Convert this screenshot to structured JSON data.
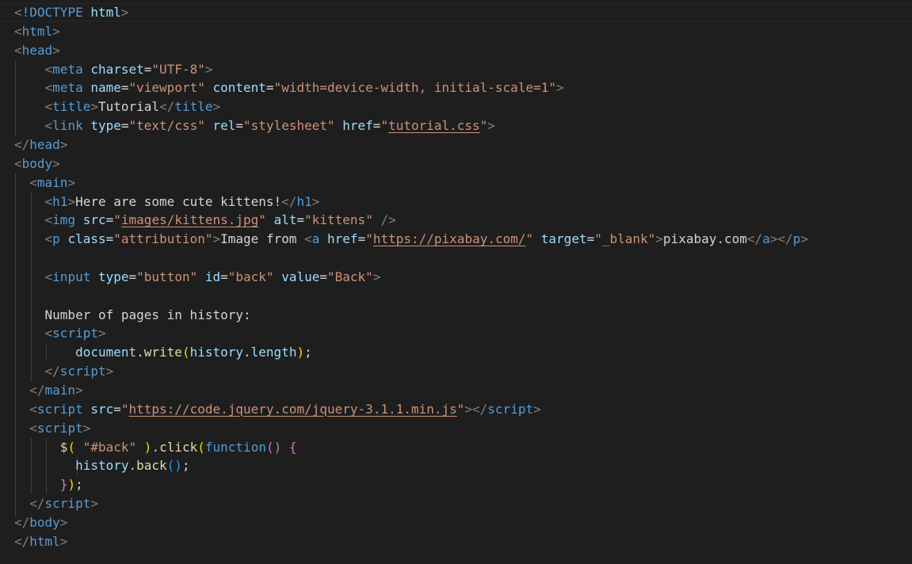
{
  "lines": [
    [
      {
        "t": "<",
        "c": "t-punc"
      },
      {
        "t": "!DOCTYPE",
        "c": "t-tag"
      },
      {
        "t": " ",
        "c": "t-text"
      },
      {
        "t": "html",
        "c": "t-attr"
      },
      {
        "t": ">",
        "c": "t-punc"
      }
    ],
    [
      {
        "t": "<",
        "c": "t-punc"
      },
      {
        "t": "html",
        "c": "t-tag"
      },
      {
        "t": ">",
        "c": "t-punc"
      }
    ],
    [
      {
        "t": "<",
        "c": "t-punc"
      },
      {
        "t": "head",
        "c": "t-tag"
      },
      {
        "t": ">",
        "c": "t-punc"
      }
    ],
    [
      {
        "t": "    ",
        "c": "t-text"
      },
      {
        "t": "<",
        "c": "t-punc"
      },
      {
        "t": "meta",
        "c": "t-tag"
      },
      {
        "t": " ",
        "c": "t-text"
      },
      {
        "t": "charset",
        "c": "t-attr"
      },
      {
        "t": "=",
        "c": "t-text"
      },
      {
        "t": "\"UTF-8\"",
        "c": "t-str"
      },
      {
        "t": ">",
        "c": "t-punc"
      }
    ],
    [
      {
        "t": "    ",
        "c": "t-text"
      },
      {
        "t": "<",
        "c": "t-punc"
      },
      {
        "t": "meta",
        "c": "t-tag"
      },
      {
        "t": " ",
        "c": "t-text"
      },
      {
        "t": "name",
        "c": "t-attr"
      },
      {
        "t": "=",
        "c": "t-text"
      },
      {
        "t": "\"viewport\"",
        "c": "t-str"
      },
      {
        "t": " ",
        "c": "t-text"
      },
      {
        "t": "content",
        "c": "t-attr"
      },
      {
        "t": "=",
        "c": "t-text"
      },
      {
        "t": "\"width=device-width, initial-scale=1\"",
        "c": "t-str"
      },
      {
        "t": ">",
        "c": "t-punc"
      }
    ],
    [
      {
        "t": "    ",
        "c": "t-text"
      },
      {
        "t": "<",
        "c": "t-punc"
      },
      {
        "t": "title",
        "c": "t-tag"
      },
      {
        "t": ">",
        "c": "t-punc"
      },
      {
        "t": "Tutorial",
        "c": "t-text"
      },
      {
        "t": "</",
        "c": "t-punc"
      },
      {
        "t": "title",
        "c": "t-tag"
      },
      {
        "t": ">",
        "c": "t-punc"
      }
    ],
    [
      {
        "t": "    ",
        "c": "t-text"
      },
      {
        "t": "<",
        "c": "t-punc"
      },
      {
        "t": "link",
        "c": "t-tag"
      },
      {
        "t": " ",
        "c": "t-text"
      },
      {
        "t": "type",
        "c": "t-attr"
      },
      {
        "t": "=",
        "c": "t-text"
      },
      {
        "t": "\"text/css\"",
        "c": "t-str"
      },
      {
        "t": " ",
        "c": "t-text"
      },
      {
        "t": "rel",
        "c": "t-attr"
      },
      {
        "t": "=",
        "c": "t-text"
      },
      {
        "t": "\"stylesheet\"",
        "c": "t-str"
      },
      {
        "t": " ",
        "c": "t-text"
      },
      {
        "t": "href",
        "c": "t-attr"
      },
      {
        "t": "=",
        "c": "t-text"
      },
      {
        "t": "\"",
        "c": "t-str"
      },
      {
        "t": "tutorial.css",
        "c": "t-link"
      },
      {
        "t": "\"",
        "c": "t-str"
      },
      {
        "t": ">",
        "c": "t-punc"
      }
    ],
    [
      {
        "t": "</",
        "c": "t-punc"
      },
      {
        "t": "head",
        "c": "t-tag"
      },
      {
        "t": ">",
        "c": "t-punc"
      }
    ],
    [
      {
        "t": "<",
        "c": "t-punc"
      },
      {
        "t": "body",
        "c": "t-tag"
      },
      {
        "t": ">",
        "c": "t-punc"
      }
    ],
    [
      {
        "t": "  ",
        "c": "t-text"
      },
      {
        "t": "<",
        "c": "t-punc"
      },
      {
        "t": "main",
        "c": "t-tag"
      },
      {
        "t": ">",
        "c": "t-punc"
      }
    ],
    [
      {
        "t": "    ",
        "c": "t-text"
      },
      {
        "t": "<",
        "c": "t-punc"
      },
      {
        "t": "h1",
        "c": "t-tag"
      },
      {
        "t": ">",
        "c": "t-punc"
      },
      {
        "t": "Here are some cute kittens!",
        "c": "t-text"
      },
      {
        "t": "</",
        "c": "t-punc"
      },
      {
        "t": "h1",
        "c": "t-tag"
      },
      {
        "t": ">",
        "c": "t-punc"
      }
    ],
    [
      {
        "t": "    ",
        "c": "t-text"
      },
      {
        "t": "<",
        "c": "t-punc"
      },
      {
        "t": "img",
        "c": "t-tag"
      },
      {
        "t": " ",
        "c": "t-text"
      },
      {
        "t": "src",
        "c": "t-attr"
      },
      {
        "t": "=",
        "c": "t-text"
      },
      {
        "t": "\"",
        "c": "t-str"
      },
      {
        "t": "images/kittens.jpg",
        "c": "t-link"
      },
      {
        "t": "\"",
        "c": "t-str"
      },
      {
        "t": " ",
        "c": "t-text"
      },
      {
        "t": "alt",
        "c": "t-attr"
      },
      {
        "t": "=",
        "c": "t-text"
      },
      {
        "t": "\"kittens\"",
        "c": "t-str"
      },
      {
        "t": " ",
        "c": "t-text"
      },
      {
        "t": "/>",
        "c": "t-punc"
      }
    ],
    [
      {
        "t": "    ",
        "c": "t-text"
      },
      {
        "t": "<",
        "c": "t-punc"
      },
      {
        "t": "p",
        "c": "t-tag"
      },
      {
        "t": " ",
        "c": "t-text"
      },
      {
        "t": "class",
        "c": "t-attr"
      },
      {
        "t": "=",
        "c": "t-text"
      },
      {
        "t": "\"attribution\"",
        "c": "t-str"
      },
      {
        "t": ">",
        "c": "t-punc"
      },
      {
        "t": "Image from ",
        "c": "t-text"
      },
      {
        "t": "<",
        "c": "t-punc"
      },
      {
        "t": "a",
        "c": "t-tag"
      },
      {
        "t": " ",
        "c": "t-text"
      },
      {
        "t": "href",
        "c": "t-attr"
      },
      {
        "t": "=",
        "c": "t-text"
      },
      {
        "t": "\"",
        "c": "t-str"
      },
      {
        "t": "https://pixabay.com/",
        "c": "t-link"
      },
      {
        "t": "\"",
        "c": "t-str"
      },
      {
        "t": " ",
        "c": "t-text"
      },
      {
        "t": "target",
        "c": "t-attr"
      },
      {
        "t": "=",
        "c": "t-text"
      },
      {
        "t": "\"_blank\"",
        "c": "t-str"
      },
      {
        "t": ">",
        "c": "t-punc"
      },
      {
        "t": "pixabay.com",
        "c": "t-text"
      },
      {
        "t": "</",
        "c": "t-punc"
      },
      {
        "t": "a",
        "c": "t-tag"
      },
      {
        "t": "></",
        "c": "t-punc"
      },
      {
        "t": "p",
        "c": "t-tag"
      },
      {
        "t": ">",
        "c": "t-punc"
      }
    ],
    [],
    [
      {
        "t": "    ",
        "c": "t-text"
      },
      {
        "t": "<",
        "c": "t-punc"
      },
      {
        "t": "input",
        "c": "t-tag"
      },
      {
        "t": " ",
        "c": "t-text"
      },
      {
        "t": "type",
        "c": "t-attr"
      },
      {
        "t": "=",
        "c": "t-text"
      },
      {
        "t": "\"button\"",
        "c": "t-str"
      },
      {
        "t": " ",
        "c": "t-text"
      },
      {
        "t": "id",
        "c": "t-attr"
      },
      {
        "t": "=",
        "c": "t-text"
      },
      {
        "t": "\"back\"",
        "c": "t-str"
      },
      {
        "t": " ",
        "c": "t-text"
      },
      {
        "t": "value",
        "c": "t-attr"
      },
      {
        "t": "=",
        "c": "t-text"
      },
      {
        "t": "\"Back\"",
        "c": "t-str"
      },
      {
        "t": ">",
        "c": "t-punc"
      }
    ],
    [],
    [
      {
        "t": "    ",
        "c": "t-text"
      },
      {
        "t": "Number of pages in history:",
        "c": "t-text"
      }
    ],
    [
      {
        "t": "    ",
        "c": "t-text"
      },
      {
        "t": "<",
        "c": "t-punc"
      },
      {
        "t": "script",
        "c": "t-tag"
      },
      {
        "t": ">",
        "c": "t-punc"
      }
    ],
    [
      {
        "t": "        ",
        "c": "t-text"
      },
      {
        "t": "document",
        "c": "t-var"
      },
      {
        "t": ".",
        "c": "t-text"
      },
      {
        "t": "write",
        "c": "t-func"
      },
      {
        "t": "(",
        "c": "t-br1"
      },
      {
        "t": "history",
        "c": "t-var"
      },
      {
        "t": ".",
        "c": "t-text"
      },
      {
        "t": "length",
        "c": "t-var"
      },
      {
        "t": ")",
        "c": "t-br1"
      },
      {
        "t": ";",
        "c": "t-text"
      }
    ],
    [
      {
        "t": "    ",
        "c": "t-text"
      },
      {
        "t": "</",
        "c": "t-punc"
      },
      {
        "t": "script",
        "c": "t-tag"
      },
      {
        "t": ">",
        "c": "t-punc"
      }
    ],
    [
      {
        "t": "  ",
        "c": "t-text"
      },
      {
        "t": "</",
        "c": "t-punc"
      },
      {
        "t": "main",
        "c": "t-tag"
      },
      {
        "t": ">",
        "c": "t-punc"
      }
    ],
    [
      {
        "t": "  ",
        "c": "t-text"
      },
      {
        "t": "<",
        "c": "t-punc"
      },
      {
        "t": "script",
        "c": "t-tag"
      },
      {
        "t": " ",
        "c": "t-text"
      },
      {
        "t": "src",
        "c": "t-attr"
      },
      {
        "t": "=",
        "c": "t-text"
      },
      {
        "t": "\"",
        "c": "t-str"
      },
      {
        "t": "https://code.jquery.com/jquery-3.1.1.min.js",
        "c": "t-link"
      },
      {
        "t": "\"",
        "c": "t-str"
      },
      {
        "t": "></",
        "c": "t-punc"
      },
      {
        "t": "script",
        "c": "t-tag"
      },
      {
        "t": ">",
        "c": "t-punc"
      }
    ],
    [
      {
        "t": "  ",
        "c": "t-text"
      },
      {
        "t": "<",
        "c": "t-punc"
      },
      {
        "t": "script",
        "c": "t-tag"
      },
      {
        "t": ">",
        "c": "t-punc"
      }
    ],
    [
      {
        "t": "      ",
        "c": "t-text"
      },
      {
        "t": "$",
        "c": "t-func"
      },
      {
        "t": "(",
        "c": "t-br1"
      },
      {
        "t": " ",
        "c": "t-text"
      },
      {
        "t": "\"#back\"",
        "c": "t-str"
      },
      {
        "t": " ",
        "c": "t-text"
      },
      {
        "t": ")",
        "c": "t-br1"
      },
      {
        "t": ".",
        "c": "t-text"
      },
      {
        "t": "click",
        "c": "t-func"
      },
      {
        "t": "(",
        "c": "t-br1"
      },
      {
        "t": "function",
        "c": "t-kw"
      },
      {
        "t": "()",
        "c": "t-br2"
      },
      {
        "t": " ",
        "c": "t-text"
      },
      {
        "t": "{",
        "c": "t-br2"
      }
    ],
    [
      {
        "t": "        ",
        "c": "t-text"
      },
      {
        "t": "history",
        "c": "t-var"
      },
      {
        "t": ".",
        "c": "t-text"
      },
      {
        "t": "back",
        "c": "t-func"
      },
      {
        "t": "()",
        "c": "t-br3"
      },
      {
        "t": ";",
        "c": "t-text"
      }
    ],
    [
      {
        "t": "      ",
        "c": "t-text"
      },
      {
        "t": "}",
        "c": "t-br2"
      },
      {
        "t": ")",
        "c": "t-br1"
      },
      {
        "t": ";",
        "c": "t-text"
      }
    ],
    [
      {
        "t": "  ",
        "c": "t-text"
      },
      {
        "t": "</",
        "c": "t-punc"
      },
      {
        "t": "script",
        "c": "t-tag"
      },
      {
        "t": ">",
        "c": "t-punc"
      }
    ],
    [
      {
        "t": "</",
        "c": "t-punc"
      },
      {
        "t": "body",
        "c": "t-tag"
      },
      {
        "t": ">",
        "c": "t-punc"
      }
    ],
    [
      {
        "t": "</",
        "c": "t-punc"
      },
      {
        "t": "html",
        "c": "t-tag"
      },
      {
        "t": ">",
        "c": "t-punc"
      }
    ]
  ]
}
